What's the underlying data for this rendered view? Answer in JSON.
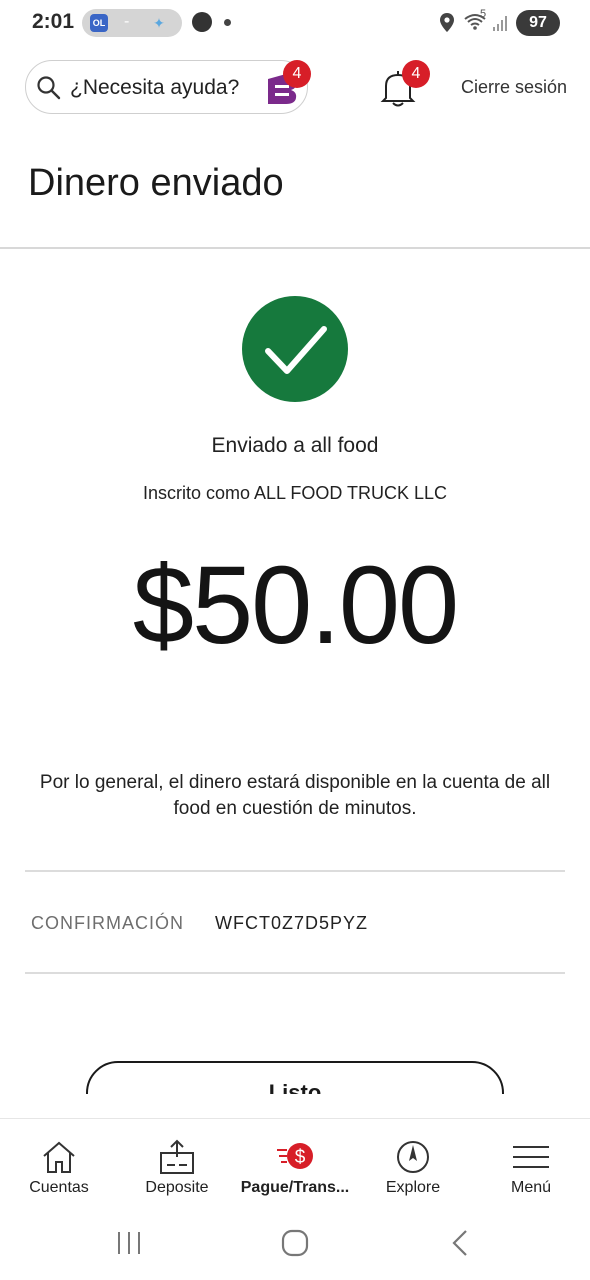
{
  "status_bar": {
    "time": "2:01",
    "wifi_superscript": "5",
    "battery": "97",
    "pill_dash": "-",
    "pill_team1": "OL"
  },
  "header": {
    "search_label": "¿Necesita ayuda?",
    "assistant_badge": "4",
    "notifications_badge": "4",
    "sign_out": "Cierre sesión"
  },
  "page": {
    "title": "Dinero enviado",
    "sent_to": "Enviado a all food",
    "enrolled_as": "Inscrito como ALL FOOD TRUCK LLC",
    "amount": "$50.00",
    "availability_note": "Por lo general, el dinero estará disponible en la cuenta de all food en cuestión de minutos.",
    "confirmation_label": "CONFIRMACIÓN",
    "confirmation_value": "WFCT0Z7D5PYZ",
    "done_button": "Listo"
  },
  "bottom_nav": {
    "items": [
      {
        "label": "Cuentas",
        "icon": "home-icon"
      },
      {
        "label": "Deposite",
        "icon": "deposit-icon"
      },
      {
        "label": "Pague/Trans...",
        "icon": "pay-transfer-icon",
        "active": true
      },
      {
        "label": "Explore",
        "icon": "compass-icon"
      },
      {
        "label": "Menú",
        "icon": "menu-icon"
      }
    ]
  },
  "colors": {
    "success_green": "#16793d",
    "badge_red": "#d71e28",
    "assistant_purple": "#7b2a8b"
  }
}
